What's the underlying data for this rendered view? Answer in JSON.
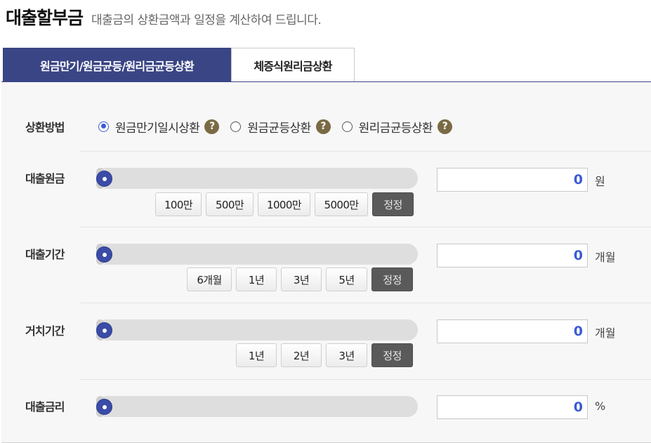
{
  "header": {
    "title": "대출할부금",
    "subtitle": "대출금의 상환금액과 일정을 계산하여 드립니다."
  },
  "tabs": [
    {
      "label": "원금만기/원금균등/원리금균등상환",
      "active": true
    },
    {
      "label": "체증식원리금상환",
      "active": false
    }
  ],
  "repayment_method": {
    "label": "상환방법",
    "options": [
      {
        "label": "원금만기일시상환",
        "checked": true
      },
      {
        "label": "원금균등상환",
        "checked": false
      },
      {
        "label": "원리금균등상환",
        "checked": false
      }
    ],
    "help_glyph": "?"
  },
  "fields": {
    "principal": {
      "label": "대출원금",
      "value": "0",
      "unit": "원",
      "slider_fraction": 0
    },
    "period": {
      "label": "대출기간",
      "value": "0",
      "unit": "개월",
      "slider_fraction": 0
    },
    "grace": {
      "label": "거치기간",
      "value": "0",
      "unit": "개월",
      "slider_fraction": 0
    },
    "rate": {
      "label": "대출금리",
      "value": "0",
      "unit": "%",
      "slider_fraction": 0
    }
  },
  "quick_buttons": {
    "principal": [
      "100만",
      "500만",
      "1000만",
      "5000만",
      "정정"
    ],
    "period": [
      "6개월",
      "1년",
      "3년",
      "5년",
      "정정"
    ],
    "grace": [
      "1년",
      "2년",
      "3년",
      "정정"
    ]
  },
  "colors": {
    "accent": "#3a4585",
    "value_text": "#3b5bd6",
    "help_icon": "#7a6a44",
    "reset_button": "#5a5a5a"
  }
}
